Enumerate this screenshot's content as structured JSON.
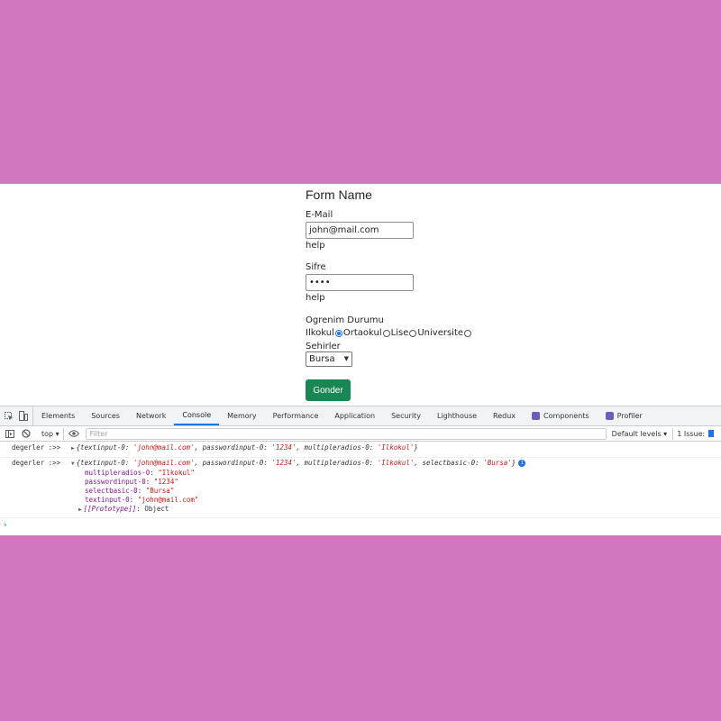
{
  "form": {
    "title": "Form Name",
    "email_label": "E-Mail",
    "email_value": "john@mail.com",
    "email_help": "help",
    "password_label": "Sifre",
    "password_value": "••••",
    "password_help": "help",
    "education_label": "Ogrenim Durumu",
    "radios": [
      {
        "label": "Ilkokul",
        "checked": true
      },
      {
        "label": "Ortaokul",
        "checked": false
      },
      {
        "label": "Lise",
        "checked": false
      },
      {
        "label": "Universite",
        "checked": false
      }
    ],
    "city_label": "Sehirler",
    "city_value": "Bursa",
    "submit_label": "Gonder"
  },
  "devtools": {
    "tabs": [
      "Elements",
      "Sources",
      "Network",
      "Console",
      "Memory",
      "Performance",
      "Application",
      "Security",
      "Lighthouse",
      "Redux",
      "Components",
      "Profiler"
    ],
    "active_tab": "Console",
    "context": "top ▾",
    "filter_placeholder": "Filter",
    "levels": "Default levels ▾",
    "issues": "1 Issue:",
    "accent_color": "#1a73e8"
  },
  "console": {
    "log1": {
      "label": "degerler :>>",
      "open": "{",
      "k1": "textinput-0",
      "v1": "'john@mail.com'",
      "k2": "passwordinput-0",
      "v2": "'1234'",
      "k3": "multipleradios-0",
      "v3": "'Ilkokul'",
      "close": "}"
    },
    "log2": {
      "label": "degerler :>>",
      "open": "{",
      "k1": "textinput-0",
      "v1": "'john@mail.com'",
      "k2": "passwordinput-0",
      "v2": "'1234'",
      "k3": "multipleradios-0",
      "v3": "'Ilkokul'",
      "k4": "selectbasic-0",
      "v4": "'Bursa'",
      "close": "}",
      "info": "i",
      "props": [
        {
          "key": "multipleradios-0",
          "value": "\"Ilkokul\""
        },
        {
          "key": "passwordinput-0",
          "value": "\"1234\""
        },
        {
          "key": "selectbasic-0",
          "value": "\"Bursa\""
        },
        {
          "key": "textinput-0",
          "value": "\"john@mail.com\""
        }
      ],
      "proto_key": "[[Prototype]]",
      "proto_value": "Object"
    },
    "prompt": "›"
  }
}
